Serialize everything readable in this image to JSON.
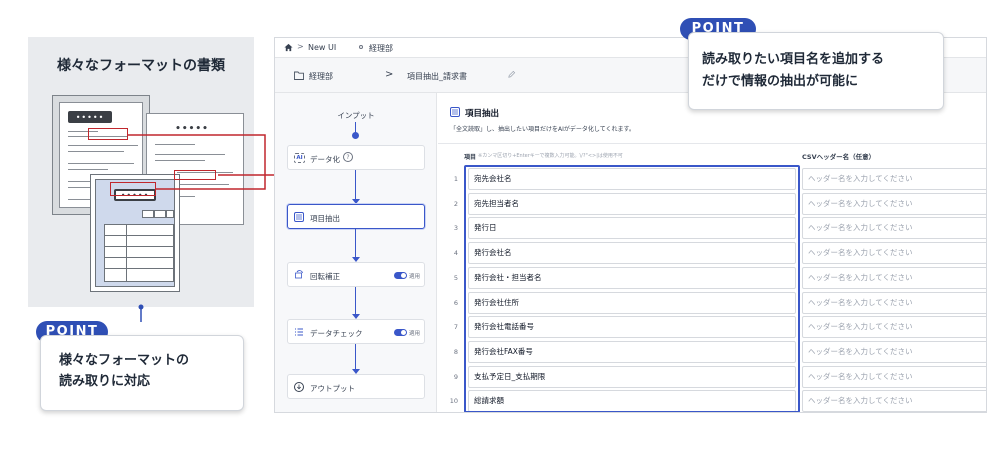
{
  "left_panel": {
    "title": "様々なフォーマットの書類",
    "doc_codes": [
      "•••••",
      "•••••",
      "•••••"
    ]
  },
  "point_left": {
    "badge": "POINT",
    "line1": "様々なフォーマットの",
    "line2": "読み取りに対応"
  },
  "point_right": {
    "badge": "POINT",
    "line1": "読み取りたい項目名を追加する",
    "line2": "だけで情報の抽出が可能に"
  },
  "app": {
    "topbar": {
      "home": "New UI",
      "crumb": "経理部"
    },
    "header": {
      "folder": "経理部",
      "title": "項目抽出_請求書"
    },
    "flow": {
      "input_label": "インプット",
      "steps": [
        {
          "label": "データ化",
          "icon": "ai-icon"
        },
        {
          "label": "項目抽出",
          "icon": "list-icon"
        },
        {
          "label": "回転補正",
          "icon": "rotate-icon",
          "toggle_label": "適用"
        },
        {
          "label": "データチェック",
          "icon": "checklist-icon",
          "toggle_label": "適用"
        },
        {
          "label": "アウトプット",
          "icon": "download-icon"
        }
      ]
    },
    "section": {
      "title": "項目抽出",
      "description": "「全文読取」し、抽出したい項目だけをAIがデータ化してくれます。",
      "col_item": "項目",
      "col_item_hint": "※カンマ区切り+Enterキーで複数入力可能。\\/?\"<>|は使用不可",
      "col_csv": "CSVヘッダー名（任意）"
    },
    "rows": [
      {
        "num": "1",
        "label": "宛先会社名"
      },
      {
        "num": "2",
        "label": "宛先担当者名"
      },
      {
        "num": "3",
        "label": "発行日"
      },
      {
        "num": "4",
        "label": "発行会社名"
      },
      {
        "num": "5",
        "label": "発行会社・担当者名"
      },
      {
        "num": "6",
        "label": "発行会社住所"
      },
      {
        "num": "7",
        "label": "発行会社電話番号"
      },
      {
        "num": "8",
        "label": "発行会社FAX番号"
      },
      {
        "num": "9",
        "label": "支払予定日_支払期限"
      },
      {
        "num": "10",
        "label": "総請求額"
      }
    ],
    "csv_placeholder": "ヘッダー名を入力してください"
  },
  "colors": {
    "accent_blue": "#2f4fb5",
    "highlight_red": "#c0272d",
    "panel_gray": "#e9ebee"
  }
}
